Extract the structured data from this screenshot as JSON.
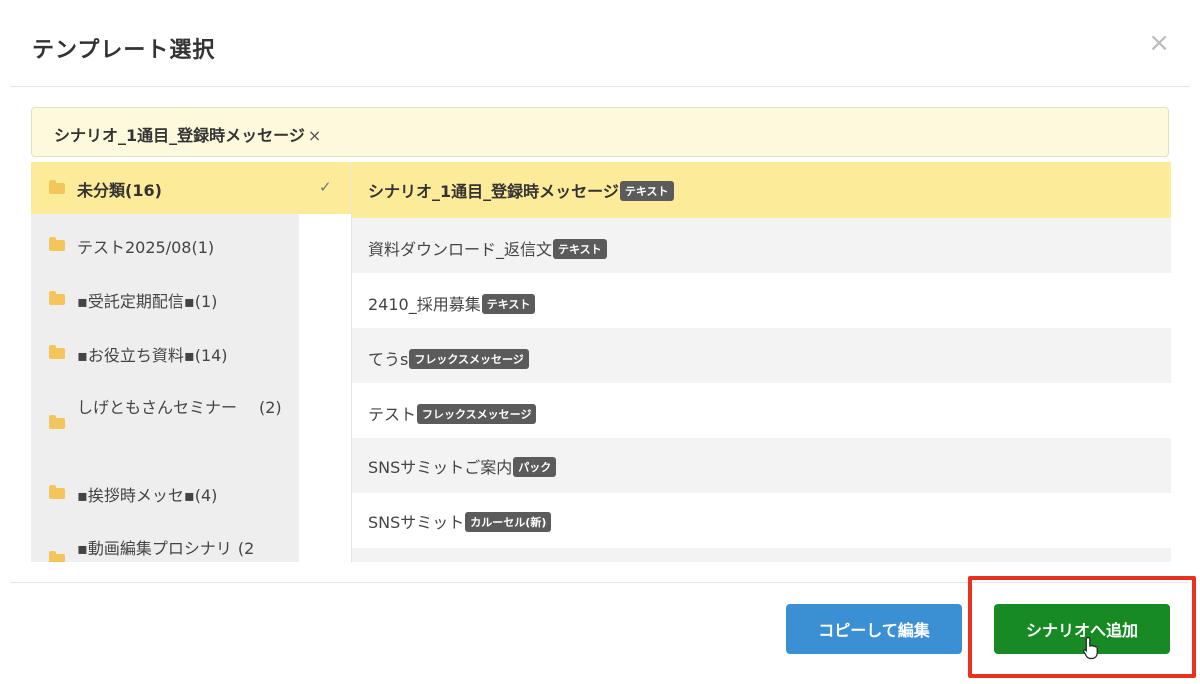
{
  "modal": {
    "title": "テンプレート選択",
    "close_glyph": "×"
  },
  "selected": {
    "label": "シナリオ_1通目_登録時メッセージ",
    "remove_glyph": "×"
  },
  "folders": [
    {
      "name": "未分類",
      "count": "(16)",
      "active": true,
      "icon": "folder-open-icon"
    },
    {
      "name": "テスト2025/08",
      "count": "(1)",
      "active": false,
      "icon": "folder-icon"
    },
    {
      "name": "▪受託定期配信▪",
      "count": "(1)",
      "active": false,
      "icon": "folder-icon"
    },
    {
      "name": "▪お役立ち資料▪",
      "count": "(14)",
      "active": false,
      "icon": "folder-icon"
    },
    {
      "name": "しげともさんセミナー",
      "count": "(2)",
      "active": false,
      "icon": "folder-icon"
    },
    {
      "name": "▪挨拶時メッセ▪",
      "count": "(4)",
      "active": false,
      "icon": "folder-icon"
    },
    {
      "name": "▪動画編集プロシナリ",
      "count": "(2",
      "active": false,
      "icon": "folder-icon"
    }
  ],
  "check_glyph": "✓",
  "templates": [
    {
      "name": "シナリオ_1通目_登録時メッセージ",
      "type": "テキスト",
      "active": true
    },
    {
      "name": "資料ダウンロード_返信文",
      "type": "テキスト",
      "active": false
    },
    {
      "name": "2410_採用募集",
      "type": "テキスト",
      "active": false
    },
    {
      "name": "てうs",
      "type": "フレックスメッセージ",
      "active": false
    },
    {
      "name": "テスト",
      "type": "フレックスメッセージ",
      "active": false
    },
    {
      "name": "SNSサミットご案内",
      "type": "パック",
      "active": false
    },
    {
      "name": "SNSサミット",
      "type": "カルーセル(新)",
      "active": false
    }
  ],
  "buttons": {
    "copy_edit": "コピーして編集",
    "add_to_scenario": "シナリオへ追加"
  },
  "colors": {
    "active_row": "#fcec9a",
    "selected_bar": "#fdf9dc",
    "copy_button": "#3b8fd3",
    "add_button": "#178a23",
    "highlight": "#e8321f",
    "badge": "#5b5b5b"
  }
}
